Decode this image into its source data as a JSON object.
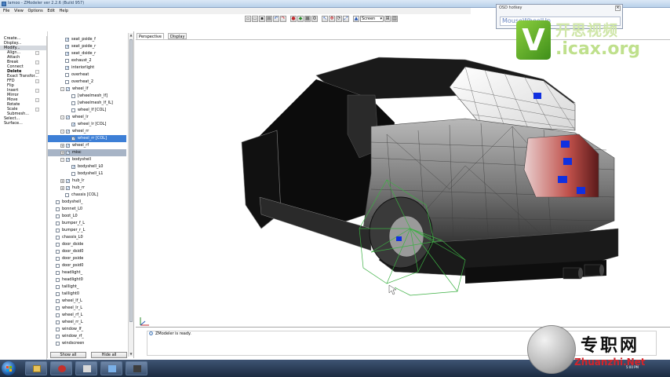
{
  "window": {
    "title": "lamoo - ZModeler ver 2.2.6 (Build 957)"
  },
  "menu": {
    "items": [
      "File",
      "View",
      "Options",
      "Edit",
      "Help"
    ]
  },
  "toolbar": {
    "view_select": "Screen"
  },
  "osd": {
    "title": "OSD hotkey",
    "text": "MouseWheelUp"
  },
  "commands": [
    {
      "label": "Create...",
      "indent": false,
      "style": ""
    },
    {
      "label": "Display...",
      "indent": false,
      "style": ""
    },
    {
      "label": "Modify...",
      "indent": false,
      "style": "highlight"
    },
    {
      "label": "Align...",
      "indent": true,
      "style": ""
    },
    {
      "label": "Attach",
      "indent": true,
      "style": ""
    },
    {
      "label": "Break",
      "indent": true,
      "style": ""
    },
    {
      "label": "Connect",
      "indent": true,
      "style": ""
    },
    {
      "label": "Delete",
      "indent": true,
      "style": "selected"
    },
    {
      "label": "Exact Transfor...",
      "indent": true,
      "style": ""
    },
    {
      "label": "FFD",
      "indent": true,
      "style": ""
    },
    {
      "label": "Flip",
      "indent": true,
      "style": ""
    },
    {
      "label": "Insert",
      "indent": true,
      "style": ""
    },
    {
      "label": "Mirror",
      "indent": true,
      "style": ""
    },
    {
      "label": "Move",
      "indent": true,
      "style": ""
    },
    {
      "label": "Rotate",
      "indent": true,
      "style": ""
    },
    {
      "label": "Scale",
      "indent": true,
      "style": ""
    },
    {
      "label": "Submesh...",
      "indent": true,
      "style": ""
    },
    {
      "label": "Select...",
      "indent": false,
      "style": ""
    },
    {
      "label": "Surface...",
      "indent": false,
      "style": ""
    }
  ],
  "tree": [
    {
      "label": "seat_pside_f",
      "level": 2,
      "checked": true,
      "expander": "",
      "style": ""
    },
    {
      "label": "seat_pside_r",
      "level": 2,
      "checked": true,
      "expander": "",
      "style": ""
    },
    {
      "label": "seat_dside_r",
      "level": 2,
      "checked": true,
      "expander": "",
      "style": ""
    },
    {
      "label": "exhaust_2",
      "level": 2,
      "checked": false,
      "expander": "",
      "style": ""
    },
    {
      "label": "interiorlight",
      "level": 2,
      "checked": true,
      "expander": "",
      "style": ""
    },
    {
      "label": "overheat",
      "level": 2,
      "checked": false,
      "expander": "",
      "style": ""
    },
    {
      "label": "overheat_2",
      "level": 2,
      "checked": false,
      "expander": "",
      "style": ""
    },
    {
      "label": "wheel_lf",
      "level": 1,
      "checked": true,
      "expander": "-",
      "style": ""
    },
    {
      "label": "[wheelmesh_lf]",
      "level": 3,
      "checked": false,
      "expander": "",
      "style": ""
    },
    {
      "label": "[wheelmesh_lf_IL]",
      "level": 3,
      "checked": false,
      "expander": "",
      "style": ""
    },
    {
      "label": "wheel_lf [COL]",
      "level": 3,
      "checked": false,
      "expander": "",
      "style": ""
    },
    {
      "label": "wheel_lr",
      "level": 1,
      "checked": true,
      "expander": "-",
      "style": ""
    },
    {
      "label": "wheel_lr [COL]",
      "level": 3,
      "checked": true,
      "expander": "",
      "style": ""
    },
    {
      "label": "wheel_rr",
      "level": 1,
      "checked": true,
      "expander": "-",
      "style": ""
    },
    {
      "label": "wheel_rr [COL]",
      "level": 3,
      "checked": true,
      "expander": "",
      "style": "sel"
    },
    {
      "label": "wheel_rf",
      "level": 1,
      "checked": true,
      "expander": "+",
      "style": ""
    },
    {
      "label": "misc",
      "level": 1,
      "checked": true,
      "expander": "+",
      "style": "sel2"
    },
    {
      "label": "bodyshell",
      "level": 1,
      "checked": true,
      "expander": "-",
      "style": ""
    },
    {
      "label": "bodyshell_L0",
      "level": 3,
      "checked": true,
      "expander": "",
      "style": ""
    },
    {
      "label": "bodyshell_L1",
      "level": 3,
      "checked": false,
      "expander": "",
      "style": ""
    },
    {
      "label": "hub_lr",
      "level": 1,
      "checked": true,
      "expander": "+",
      "style": ""
    },
    {
      "label": "hub_rr",
      "level": 1,
      "checked": true,
      "expander": "+",
      "style": ""
    },
    {
      "label": "chassis [COL]",
      "level": 2,
      "checked": false,
      "expander": "",
      "style": ""
    },
    {
      "label": "bodyshell_",
      "level": 0,
      "checked": false,
      "expander": "",
      "style": ""
    },
    {
      "label": "bonnet_L0",
      "level": 0,
      "checked": false,
      "expander": "",
      "style": ""
    },
    {
      "label": "boot_L0",
      "level": 0,
      "checked": false,
      "expander": "",
      "style": ""
    },
    {
      "label": "bumper_f_L",
      "level": 0,
      "checked": false,
      "expander": "",
      "style": ""
    },
    {
      "label": "bumper_r_L",
      "level": 0,
      "checked": false,
      "expander": "",
      "style": ""
    },
    {
      "label": "chassis_L0",
      "level": 0,
      "checked": false,
      "expander": "",
      "style": ""
    },
    {
      "label": "door_dside",
      "level": 0,
      "checked": false,
      "expander": "",
      "style": ""
    },
    {
      "label": "door_dsid0",
      "level": 0,
      "checked": false,
      "expander": "",
      "style": ""
    },
    {
      "label": "door_pside",
      "level": 0,
      "checked": false,
      "expander": "",
      "style": ""
    },
    {
      "label": "door_psid0",
      "level": 0,
      "checked": false,
      "expander": "",
      "style": ""
    },
    {
      "label": "headlight_",
      "level": 0,
      "checked": false,
      "expander": "",
      "style": ""
    },
    {
      "label": "headlight0",
      "level": 0,
      "checked": false,
      "expander": "",
      "style": ""
    },
    {
      "label": "taillight_",
      "level": 0,
      "checked": false,
      "expander": "",
      "style": ""
    },
    {
      "label": "taillight0",
      "level": 0,
      "checked": false,
      "expander": "",
      "style": ""
    },
    {
      "label": "wheel_lf_L",
      "level": 0,
      "checked": false,
      "expander": "",
      "style": ""
    },
    {
      "label": "wheel_lr_L",
      "level": 0,
      "checked": false,
      "expander": "",
      "style": ""
    },
    {
      "label": "wheel_rf_L",
      "level": 0,
      "checked": false,
      "expander": "",
      "style": ""
    },
    {
      "label": "wheel_rr_L",
      "level": 0,
      "checked": false,
      "expander": "",
      "style": ""
    },
    {
      "label": "window_lf_",
      "level": 0,
      "checked": false,
      "expander": "",
      "style": ""
    },
    {
      "label": "window_rf_",
      "level": 0,
      "checked": false,
      "expander": "",
      "style": ""
    },
    {
      "label": "windscreen",
      "level": 0,
      "checked": false,
      "expander": "",
      "style": ""
    }
  ],
  "tree_buttons": {
    "show_all": "Show all",
    "hide_all": "Hide all"
  },
  "viewport": {
    "tab_active": "Perspective",
    "tab_display": "Display"
  },
  "log": {
    "message": "ZModeler is ready."
  },
  "taskbar": {
    "time": "5:00 PM"
  },
  "watermarks": {
    "top_cn": "开思视频",
    "top_url": ".icax.org",
    "top_logo": "V",
    "bottom_cn": "专职网",
    "bottom_url": "Zhuanzhi.Net"
  },
  "colors": {
    "selection": "#3d7fd6",
    "osd_text": "#6a86c2",
    "wheel_wire": "#3cb043",
    "marker": "#1030e0"
  }
}
